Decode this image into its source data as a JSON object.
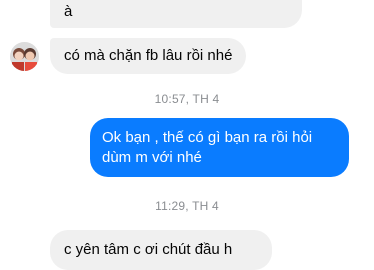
{
  "messages": [
    {
      "sender": "other",
      "text": "à"
    },
    {
      "sender": "other",
      "text": "có mà chặn fb lâu rồi nhé"
    },
    {
      "sender": "me",
      "text": "Ok bạn , thế có gì bạn ra rồi hỏi dùm m với nhé"
    },
    {
      "sender": "other",
      "text": "c yên tâm c ơi chút đầu h"
    }
  ],
  "timestamps": [
    "10:57, TH 4",
    "11:29, TH 4"
  ],
  "colors": {
    "outgoing_bubble": "#0a7cff",
    "incoming_bubble": "#f0f0f0",
    "timestamp_text": "#8a8d91"
  },
  "icons": {
    "avatar": "contact-avatar-icon"
  }
}
